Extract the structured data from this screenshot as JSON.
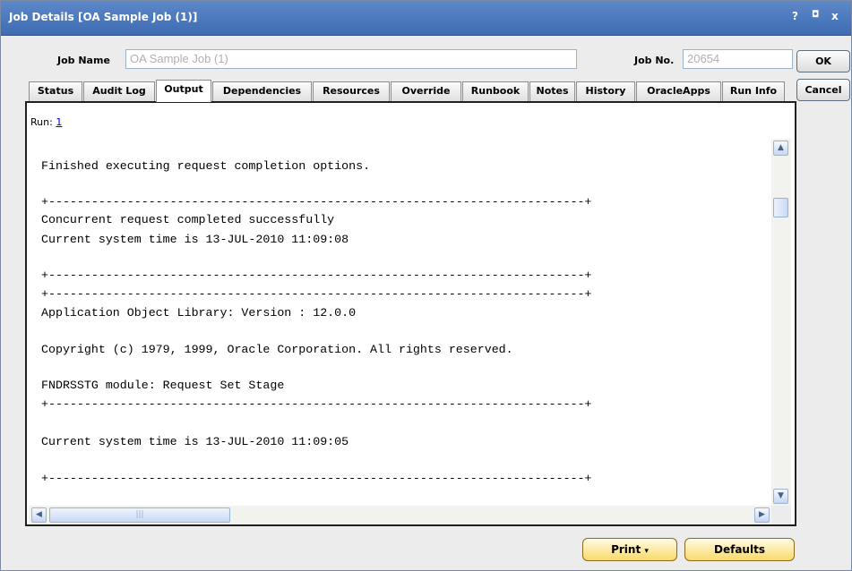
{
  "window": {
    "title": "Job Details [OA Sample Job (1)]"
  },
  "title_controls": {
    "help": "?",
    "maximize": "◘",
    "close": "x"
  },
  "header": {
    "job_name_label": "Job Name",
    "job_name_value": "OA Sample Job (1)",
    "job_no_label": "Job No.",
    "job_no_value": "20654"
  },
  "side_buttons": {
    "ok": "OK",
    "cancel": "Cancel"
  },
  "tabs": [
    {
      "label": "Status",
      "active": false
    },
    {
      "label": "Audit Log",
      "active": false
    },
    {
      "label": "Output",
      "active": true
    },
    {
      "label": "Dependencies",
      "active": false
    },
    {
      "label": "Resources",
      "active": false
    },
    {
      "label": "Override",
      "active": false
    },
    {
      "label": "Runbook",
      "active": false
    },
    {
      "label": "Notes",
      "active": false
    },
    {
      "label": "History",
      "active": false
    },
    {
      "label": "OracleApps",
      "active": false
    },
    {
      "label": "Run Info",
      "active": false
    }
  ],
  "output": {
    "run_label": "Run:",
    "run_link": "1",
    "lines": [
      "Finished executing request completion options.",
      "",
      "+---------------------------------------------------------------------------+",
      "Concurrent request completed successfully",
      "Current system time is 13-JUL-2010 11:09:08",
      "",
      "+---------------------------------------------------------------------------+",
      "+---------------------------------------------------------------------------+",
      "Application Object Library: Version : 12.0.0",
      "",
      "Copyright (c) 1979, 1999, Oracle Corporation. All rights reserved.",
      "",
      "FNDRSSTG module: Request Set Stage",
      "+---------------------------------------------------------------------------+",
      "",
      "Current system time is 13-JUL-2010 11:09:05",
      "",
      "+---------------------------------------------------------------------------+"
    ]
  },
  "footer": {
    "print_label": "Print",
    "print_caret": "▾",
    "defaults_label": "Defaults"
  },
  "colors": {
    "titlebar": "#4a79bf",
    "accent_button": "#f9da6b",
    "link": "#0000cc"
  }
}
